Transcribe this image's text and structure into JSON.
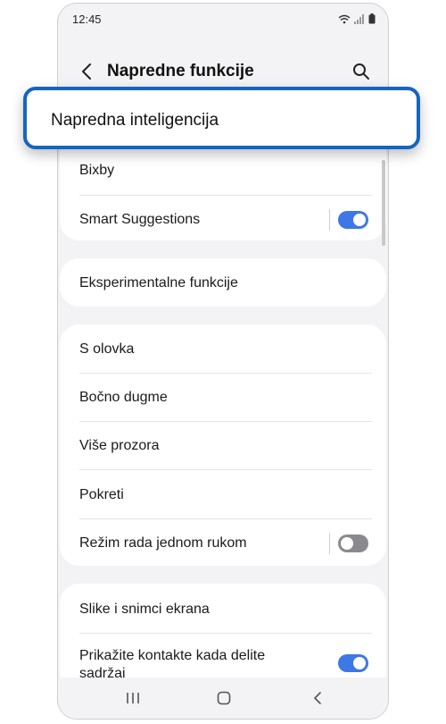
{
  "status": {
    "time": "12:45"
  },
  "header": {
    "title": "Napredne funkcije"
  },
  "highlight": {
    "label": "Napredna inteligencija"
  },
  "group1": [
    {
      "label": "Bixby"
    },
    {
      "label": "Smart Suggestions",
      "toggle": "on"
    }
  ],
  "group2": [
    {
      "label": "Eksperimentalne funkcije"
    }
  ],
  "group3": [
    {
      "label": "S olovka"
    },
    {
      "label": "Bočno dugme"
    },
    {
      "label": "Više prozora"
    },
    {
      "label": "Pokreti"
    },
    {
      "label": "Režim rada jednom rukom",
      "toggle": "off"
    }
  ],
  "group4": [
    {
      "label": "Slike i snimci ekrana"
    },
    {
      "label": "Prikažite kontakte kada delite sadržaj",
      "toggle": "on"
    }
  ],
  "colors": {
    "accent": "#3e78e6",
    "highlight_border": "#1565c0"
  },
  "icons": [
    "back-arrow-icon",
    "search-icon",
    "wifi-icon",
    "signal-icon",
    "battery-icon",
    "recents-icon",
    "home-icon",
    "back-nav-icon"
  ]
}
